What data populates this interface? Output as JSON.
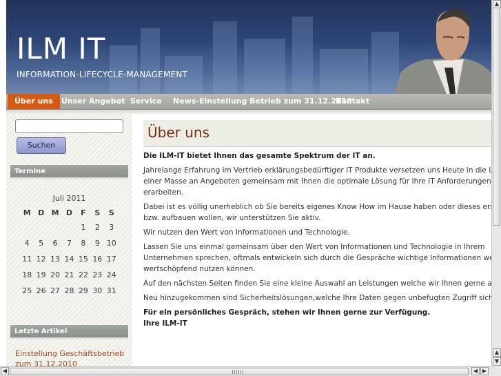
{
  "site": {
    "title": "ILM IT",
    "tagline": "INFORMATION-LIFECYCLE-MANAGEMENT"
  },
  "nav": {
    "items": [
      {
        "label": "Über uns",
        "active": true
      },
      {
        "label": "Unser Angebot",
        "active": false
      },
      {
        "label": "Service",
        "active": false
      },
      {
        "label": "News-Einstellung Betrieb zum 31.12.2010",
        "active": false
      },
      {
        "label": "Kontakt",
        "active": false
      }
    ]
  },
  "sidebar": {
    "search": {
      "value": "",
      "button_label": "Suchen"
    },
    "termine_title": "Termine",
    "calendar": {
      "month": "Juli 2011",
      "weekdays": [
        "M",
        "D",
        "M",
        "D",
        "F",
        "S",
        "S"
      ],
      "weeks": [
        [
          "",
          "",
          "",
          "",
          "1",
          "2",
          "3"
        ],
        [
          "4",
          "5",
          "6",
          "7",
          "8",
          "9",
          "10"
        ],
        [
          "11",
          "12",
          "13",
          "14",
          "15",
          "16",
          "17"
        ],
        [
          "18",
          "19",
          "20",
          "21",
          "22",
          "23",
          "24"
        ],
        [
          "25",
          "26",
          "27",
          "28",
          "29",
          "30",
          "31"
        ]
      ]
    },
    "recent_title": "Letzte Artikel",
    "recent_link": "Einstellung Geschäftsbetrieb zum 31.12.2010"
  },
  "content": {
    "title": "Über uns",
    "paragraphs": [
      {
        "text": "Die ILM-IT bietet Ihnen das gesamte Spektrum der IT an.",
        "bold": true
      },
      {
        "text": "Jahrelange Erfahrung im Vertrieb erklärungsbedürftiger IT Produkte versetzen uns Heute in die Lage aus\neiner Masse an Angeboten gemeinsam mit Ihnen die optimale Lösung für Ihre IT Anforderungen zu\nerarbeiten.",
        "bold": false
      },
      {
        "text": "Dabei ist es völlig unerheblich ob Sie bereits eigenes Know How im Hause haben oder dieses erst aus\nbzw. aufbauen wollen, wir unterstützen Sie aktiv.",
        "bold": false
      },
      {
        "text": "Wir nutzen den Wert von Informationen und Technologie.",
        "bold": false
      },
      {
        "text": "Lassen Sie uns einmal gemeinsam über den Wert von Informationen und Technologie in Ihrem\nUnternehmen sprechen, oftmals entwickeln sich durch die Gespräche wichtige Informationen welche Sie\nwertschöpfend nutzen können.",
        "bold": false
      },
      {
        "text": "Auf den nächsten Seiten finden Sie eine kleine Auswahl an Leistungen welche wir Ihnen gerne anbieten.",
        "bold": false
      },
      {
        "text": "Neu hinzugekommen sind Sicherheitslösungen,welche Ihre Daten gegen unbefugten Zugriff sichern.",
        "bold": false
      },
      {
        "text": "Für ein persönliches Gespräch, stehen wir Ihnen gerne zur Verfügung.\nIhre ILM-IT",
        "bold": true
      }
    ]
  },
  "colors": {
    "accent_orange": "#d85a10",
    "title_brown": "#7a2c10",
    "header_blue": "#2e4677"
  }
}
